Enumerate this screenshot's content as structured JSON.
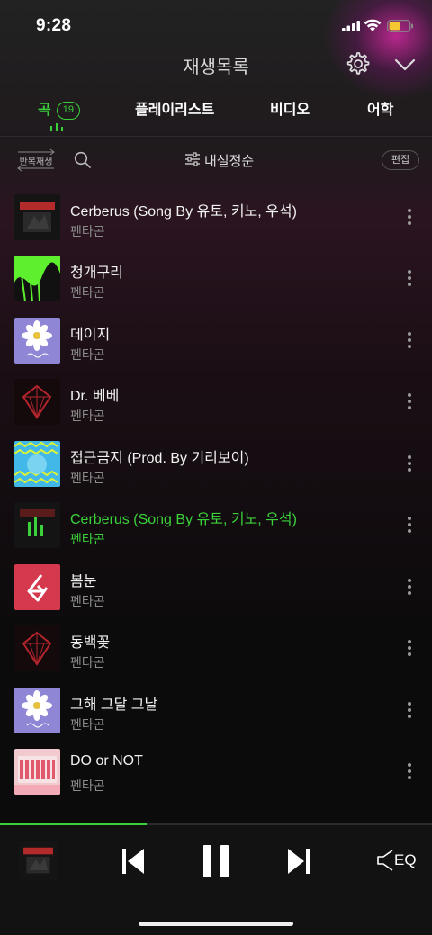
{
  "status_bar": {
    "time": "9:28"
  },
  "header": {
    "title": "재생목록"
  },
  "tabs": [
    {
      "label": "곡",
      "count": "19",
      "active": true
    },
    {
      "label": "플레이리스트"
    },
    {
      "label": "비디오"
    },
    {
      "label": "어학"
    }
  ],
  "toolbar": {
    "repeat_label": "반복재생",
    "sort_label": "내설정순",
    "edit_label": "편집"
  },
  "songs": [
    {
      "title": "Cerberus (Song By 유토, 키노, 우석)",
      "artist": "펜타곤",
      "art": "dark-red-logo-icon"
    },
    {
      "title": "청개구리",
      "artist": "펜타곤",
      "art": "green-wave-art-icon"
    },
    {
      "title": "데이지",
      "artist": "펜타곤",
      "art": "daisy-art-icon"
    },
    {
      "title": "Dr. 베베",
      "artist": "펜타곤",
      "art": "red-gem-art-icon"
    },
    {
      "title": "접근금지 (Prod. By 기리보이)",
      "artist": "펜타곤",
      "art": "blue-zigzag-art-icon"
    },
    {
      "title": "Cerberus (Song By 유토, 키노, 우석)",
      "artist": "펜타곤",
      "art": "now-playing-art-icon",
      "playing": true
    },
    {
      "title": "봄눈",
      "artist": "펜타곤",
      "art": "red-logo-art-icon"
    },
    {
      "title": "동백꽃",
      "artist": "펜타곤",
      "art": "red-gem-art-icon"
    },
    {
      "title": "그해 그달 그날",
      "artist": "펜타곤",
      "art": "daisy-art-icon"
    },
    {
      "title": "DO or NOT",
      "artist": "펜타곤",
      "art": "pink-group-art-icon"
    }
  ],
  "player": {
    "progress": 0.34,
    "eq_label": "EQ"
  },
  "colors": {
    "accent": "#3ad13a",
    "background": "#0b0b0b",
    "muted": "#8b8b8b"
  }
}
